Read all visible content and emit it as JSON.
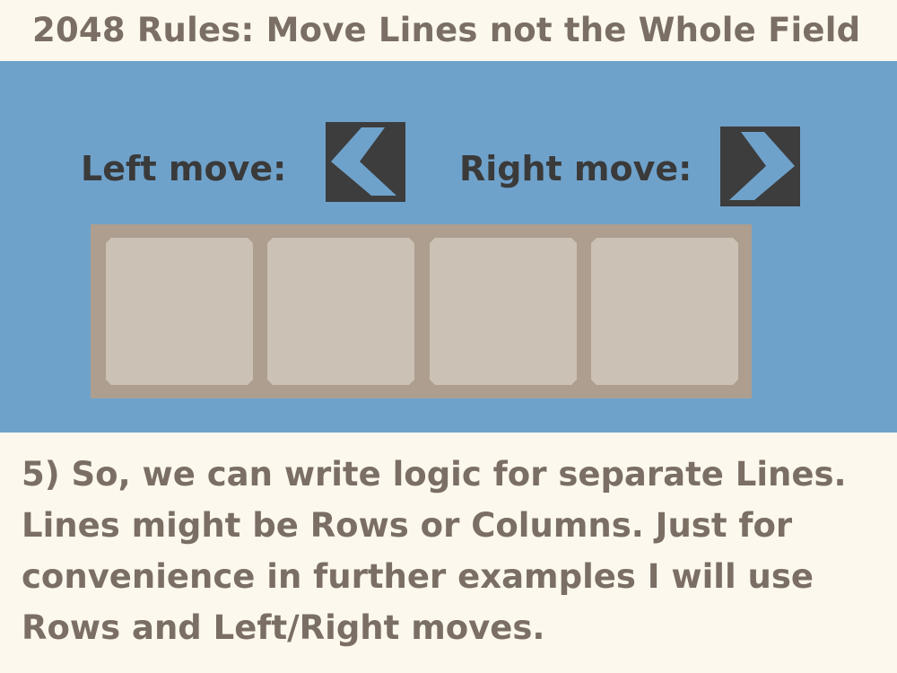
{
  "title": "2048 Rules: Move Lines not the Whole Field",
  "controls": {
    "left_label": "Left move:",
    "right_label": "Right move:",
    "left_icon": "chevron-left-icon",
    "right_icon": "chevron-right-icon"
  },
  "board": {
    "cells": [
      "",
      "",
      "",
      ""
    ]
  },
  "description": {
    "lines": [
      "5) So, we can write logic for separate Lines.",
      "Lines might be Rows or Columns. Just for",
      "convenience in further examples I will use",
      "Rows and Left/Right moves."
    ]
  },
  "colors": {
    "background": "#fcf8ee",
    "panel": "#6fa2cb",
    "text": "#7a6e65",
    "button": "#3d3d3d",
    "board": "#ad9e8f",
    "cell": "#cbc1b4"
  }
}
